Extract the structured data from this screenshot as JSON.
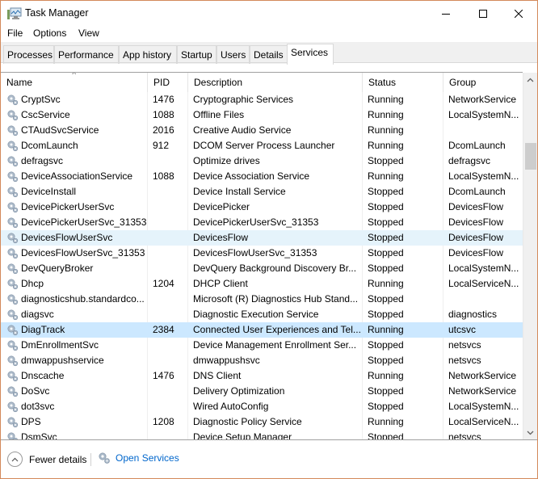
{
  "window": {
    "title": "Task Manager",
    "minimize_icon": "minimize-icon",
    "maximize_icon": "maximize-icon",
    "close_icon": "close-icon"
  },
  "menu": [
    "File",
    "Options",
    "View"
  ],
  "tabs": [
    {
      "label": "Processes",
      "active": false
    },
    {
      "label": "Performance",
      "active": false
    },
    {
      "label": "App history",
      "active": false
    },
    {
      "label": "Startup",
      "active": false
    },
    {
      "label": "Users",
      "active": false
    },
    {
      "label": "Details",
      "active": false
    },
    {
      "label": "Services",
      "active": true
    }
  ],
  "columns": {
    "name": "Name",
    "pid": "PID",
    "description": "Description",
    "status": "Status",
    "group": "Group",
    "sorted_by": "name",
    "sort_direction": "ascending"
  },
  "services": [
    {
      "name": "CryptSvc",
      "pid": "1476",
      "description": "Cryptographic Services",
      "status": "Running",
      "group": "NetworkService",
      "state": ""
    },
    {
      "name": "CscService",
      "pid": "1088",
      "description": "Offline Files",
      "status": "Running",
      "group": "LocalSystemN...",
      "state": ""
    },
    {
      "name": "CTAudSvcService",
      "pid": "2016",
      "description": "Creative Audio Service",
      "status": "Running",
      "group": "",
      "state": ""
    },
    {
      "name": "DcomLaunch",
      "pid": "912",
      "description": "DCOM Server Process Launcher",
      "status": "Running",
      "group": "DcomLaunch",
      "state": ""
    },
    {
      "name": "defragsvc",
      "pid": "",
      "description": "Optimize drives",
      "status": "Stopped",
      "group": "defragsvc",
      "state": ""
    },
    {
      "name": "DeviceAssociationService",
      "pid": "1088",
      "description": "Device Association Service",
      "status": "Running",
      "group": "LocalSystemN...",
      "state": ""
    },
    {
      "name": "DeviceInstall",
      "pid": "",
      "description": "Device Install Service",
      "status": "Stopped",
      "group": "DcomLaunch",
      "state": ""
    },
    {
      "name": "DevicePickerUserSvc",
      "pid": "",
      "description": "DevicePicker",
      "status": "Stopped",
      "group": "DevicesFlow",
      "state": ""
    },
    {
      "name": "DevicePickerUserSvc_31353",
      "pid": "",
      "description": "DevicePickerUserSvc_31353",
      "status": "Stopped",
      "group": "DevicesFlow",
      "state": ""
    },
    {
      "name": "DevicesFlowUserSvc",
      "pid": "",
      "description": "DevicesFlow",
      "status": "Stopped",
      "group": "DevicesFlow",
      "state": "hover"
    },
    {
      "name": "DevicesFlowUserSvc_31353",
      "pid": "",
      "description": "DevicesFlowUserSvc_31353",
      "status": "Stopped",
      "group": "DevicesFlow",
      "state": ""
    },
    {
      "name": "DevQueryBroker",
      "pid": "",
      "description": "DevQuery Background Discovery Br...",
      "status": "Stopped",
      "group": "LocalSystemN...",
      "state": ""
    },
    {
      "name": "Dhcp",
      "pid": "1204",
      "description": "DHCP Client",
      "status": "Running",
      "group": "LocalServiceN...",
      "state": ""
    },
    {
      "name": "diagnosticshub.standardco...",
      "pid": "",
      "description": "Microsoft (R) Diagnostics Hub Stand...",
      "status": "Stopped",
      "group": "",
      "state": ""
    },
    {
      "name": "diagsvc",
      "pid": "",
      "description": "Diagnostic Execution Service",
      "status": "Stopped",
      "group": "diagnostics",
      "state": ""
    },
    {
      "name": "DiagTrack",
      "pid": "2384",
      "description": "Connected User Experiences and Tel...",
      "status": "Running",
      "group": "utcsvc",
      "state": "selected"
    },
    {
      "name": "DmEnrollmentSvc",
      "pid": "",
      "description": "Device Management Enrollment Ser...",
      "status": "Stopped",
      "group": "netsvcs",
      "state": ""
    },
    {
      "name": "dmwappushservice",
      "pid": "",
      "description": "dmwappushsvc",
      "status": "Stopped",
      "group": "netsvcs",
      "state": ""
    },
    {
      "name": "Dnscache",
      "pid": "1476",
      "description": "DNS Client",
      "status": "Running",
      "group": "NetworkService",
      "state": ""
    },
    {
      "name": "DoSvc",
      "pid": "",
      "description": "Delivery Optimization",
      "status": "Stopped",
      "group": "NetworkService",
      "state": ""
    },
    {
      "name": "dot3svc",
      "pid": "",
      "description": "Wired AutoConfig",
      "status": "Stopped",
      "group": "LocalSystemN...",
      "state": ""
    },
    {
      "name": "DPS",
      "pid": "1208",
      "description": "Diagnostic Policy Service",
      "status": "Running",
      "group": "LocalServiceN...",
      "state": ""
    },
    {
      "name": "DsmSvc",
      "pid": "",
      "description": "Device Setup Manager",
      "status": "Stopped",
      "group": "netsvcs",
      "state": ""
    }
  ],
  "scrollbar": {
    "position_fraction": 0.18
  },
  "footer": {
    "fewer_details": "Fewer details",
    "open_services": "Open Services"
  },
  "colors": {
    "window_border": "#d3895a",
    "hover_row": "#e5f3fb",
    "selected_row": "#cce8ff",
    "link": "#0066cc"
  }
}
